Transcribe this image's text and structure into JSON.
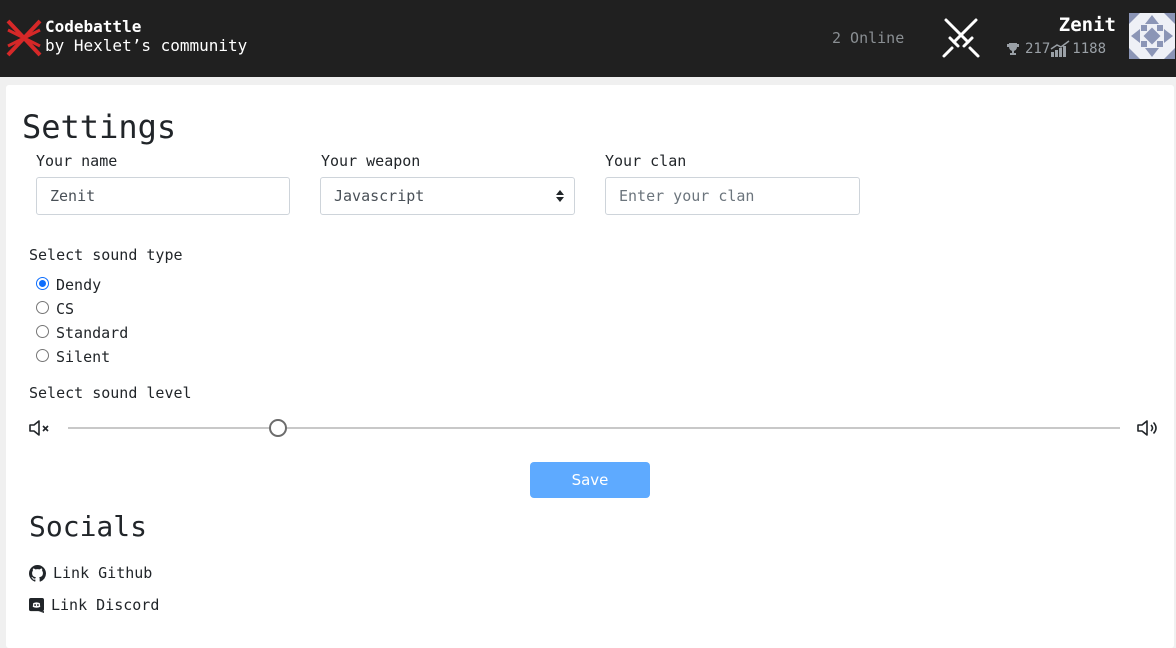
{
  "header": {
    "brand_title": "Codebattle",
    "brand_subtitle": "by Hexlet’s community",
    "online_text": "2 Online",
    "username": "Zenit",
    "rank": "217",
    "rating": "1188"
  },
  "settings": {
    "title": "Settings",
    "name_label": "Your name",
    "name_value": "Zenit",
    "weapon_label": "Your weapon",
    "weapon_value": "Javascript",
    "clan_label": "Your clan",
    "clan_placeholder": "Enter your clan",
    "sound_type_label": "Select sound type",
    "sound_types": [
      {
        "label": "Dendy",
        "checked": true
      },
      {
        "label": "CS",
        "checked": false
      },
      {
        "label": "Standard",
        "checked": false
      },
      {
        "label": "Silent",
        "checked": false
      }
    ],
    "sound_level_label": "Select sound level",
    "sound_level": 0.2,
    "save_label": "Save"
  },
  "socials": {
    "title": "Socials",
    "github_label": "Link Github",
    "discord_label": "Link Discord"
  },
  "colors": {
    "navbar": "#202020",
    "accent": "#d62828",
    "save_button": "#5eaaff",
    "radio_checked": "#0d6efd"
  }
}
